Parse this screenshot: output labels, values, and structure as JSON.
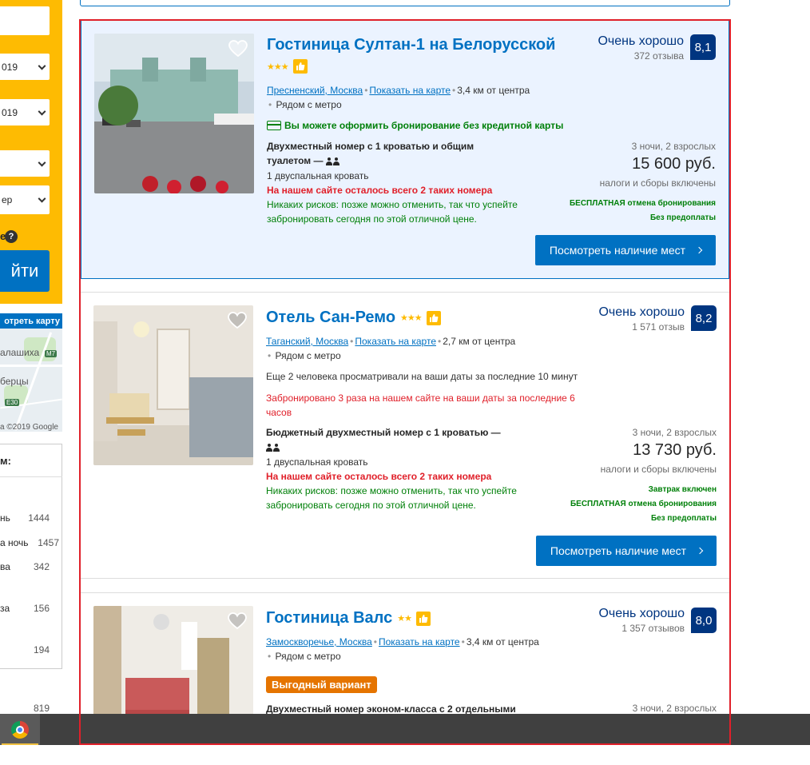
{
  "sidebar": {
    "date_in": "019",
    "date_out": "019",
    "guests_suffix": "ер",
    "search_label": "йти",
    "help_icon": "question-icon",
    "map": {
      "button_label": "отреть карту",
      "city1": "алашиха",
      "city2": "берцы",
      "badge1": "M7",
      "badge2": "E30",
      "copyright": "а ©2019 Google"
    },
    "filters": {
      "title": "м:",
      "rows": [
        {
          "label": "нь",
          "count": "1444"
        },
        {
          "label": "а ночь",
          "count": "1457"
        },
        {
          "label": "ва",
          "count": "342"
        },
        {
          "label": "за",
          "count": "156"
        },
        {
          "label": "",
          "count": "194"
        }
      ],
      "extra_count": "819"
    }
  },
  "hotels": [
    {
      "name": "Гостиница Султан-1 на Белорусской",
      "stars": "★★★",
      "district": "Пресненский, Москва",
      "show_on_map": "Показать на карте",
      "distance": "3,4 км от центра",
      "metro": "Рядом с метро",
      "no_credit_card": "Вы можете оформить бронирование без кредитной карты",
      "room_line1": "Двухместный номер с 1 кроватью и общим",
      "room_line2": "туалетом",
      "bed": "1 двуспальная кровать",
      "scarcity": "На нашем сайте осталось всего 2 таких номера",
      "no_risk": "Никаких рисков: позже можно отменить, так что успейте забронировать сегодня по этой отличной цене.",
      "rating_word": "Очень хорошо",
      "reviews": "372 отзыва",
      "score": "8,1",
      "nights": "3 ночи, 2 взрослых",
      "price": "15 600 руб.",
      "taxes": "налоги и сборы включены",
      "perks": [
        "БЕСПЛАТНАЯ отмена бронирования",
        "Без предоплаты"
      ],
      "cta": "Посмотреть наличие мест"
    },
    {
      "name": "Отель Сан-Ремо",
      "stars": "★★★",
      "district": "Таганский, Москва",
      "show_on_map": "Показать на карте",
      "distance": "2,7 км от центра",
      "metro": "Рядом с метро",
      "viewers": "Еще 2 человека просматривали на ваши даты за последние 10 минут",
      "booked": "Забронировано 3 раза на нашем сайте на ваши даты за последние 6 часов",
      "room_line1": "Бюджетный двухместный номер с 1 кроватью",
      "bed": "1 двуспальная кровать",
      "scarcity": "На нашем сайте осталось всего 2 таких номера",
      "no_risk": "Никаких рисков: позже можно отменить, так что успейте забронировать сегодня по этой отличной цене.",
      "rating_word": "Очень хорошо",
      "reviews": "1 571 отзыв",
      "score": "8,2",
      "nights": "3 ночи, 2 взрослых",
      "price": "13 730 руб.",
      "taxes": "налоги и сборы включены",
      "perks": [
        "Завтрак включен",
        "БЕСПЛАТНАЯ отмена бронирования",
        "Без предоплаты"
      ],
      "cta": "Посмотреть наличие мест"
    },
    {
      "name": "Гостиница Валс",
      "stars": "★★",
      "district": "Замоскворечье, Москва",
      "show_on_map": "Показать на карте",
      "distance": "3,4 км от центра",
      "metro": "Рядом с метро",
      "deal": "Выгодный вариант",
      "room_line1": "Двухместный номер эконом-класса с 2 отдельными",
      "rating_word": "Очень хорошо",
      "reviews": "1 357 отзывов",
      "score": "8,0",
      "nights": "3 ночи, 2 взрослых"
    }
  ],
  "taskbar": {
    "app": "chrome-icon"
  }
}
